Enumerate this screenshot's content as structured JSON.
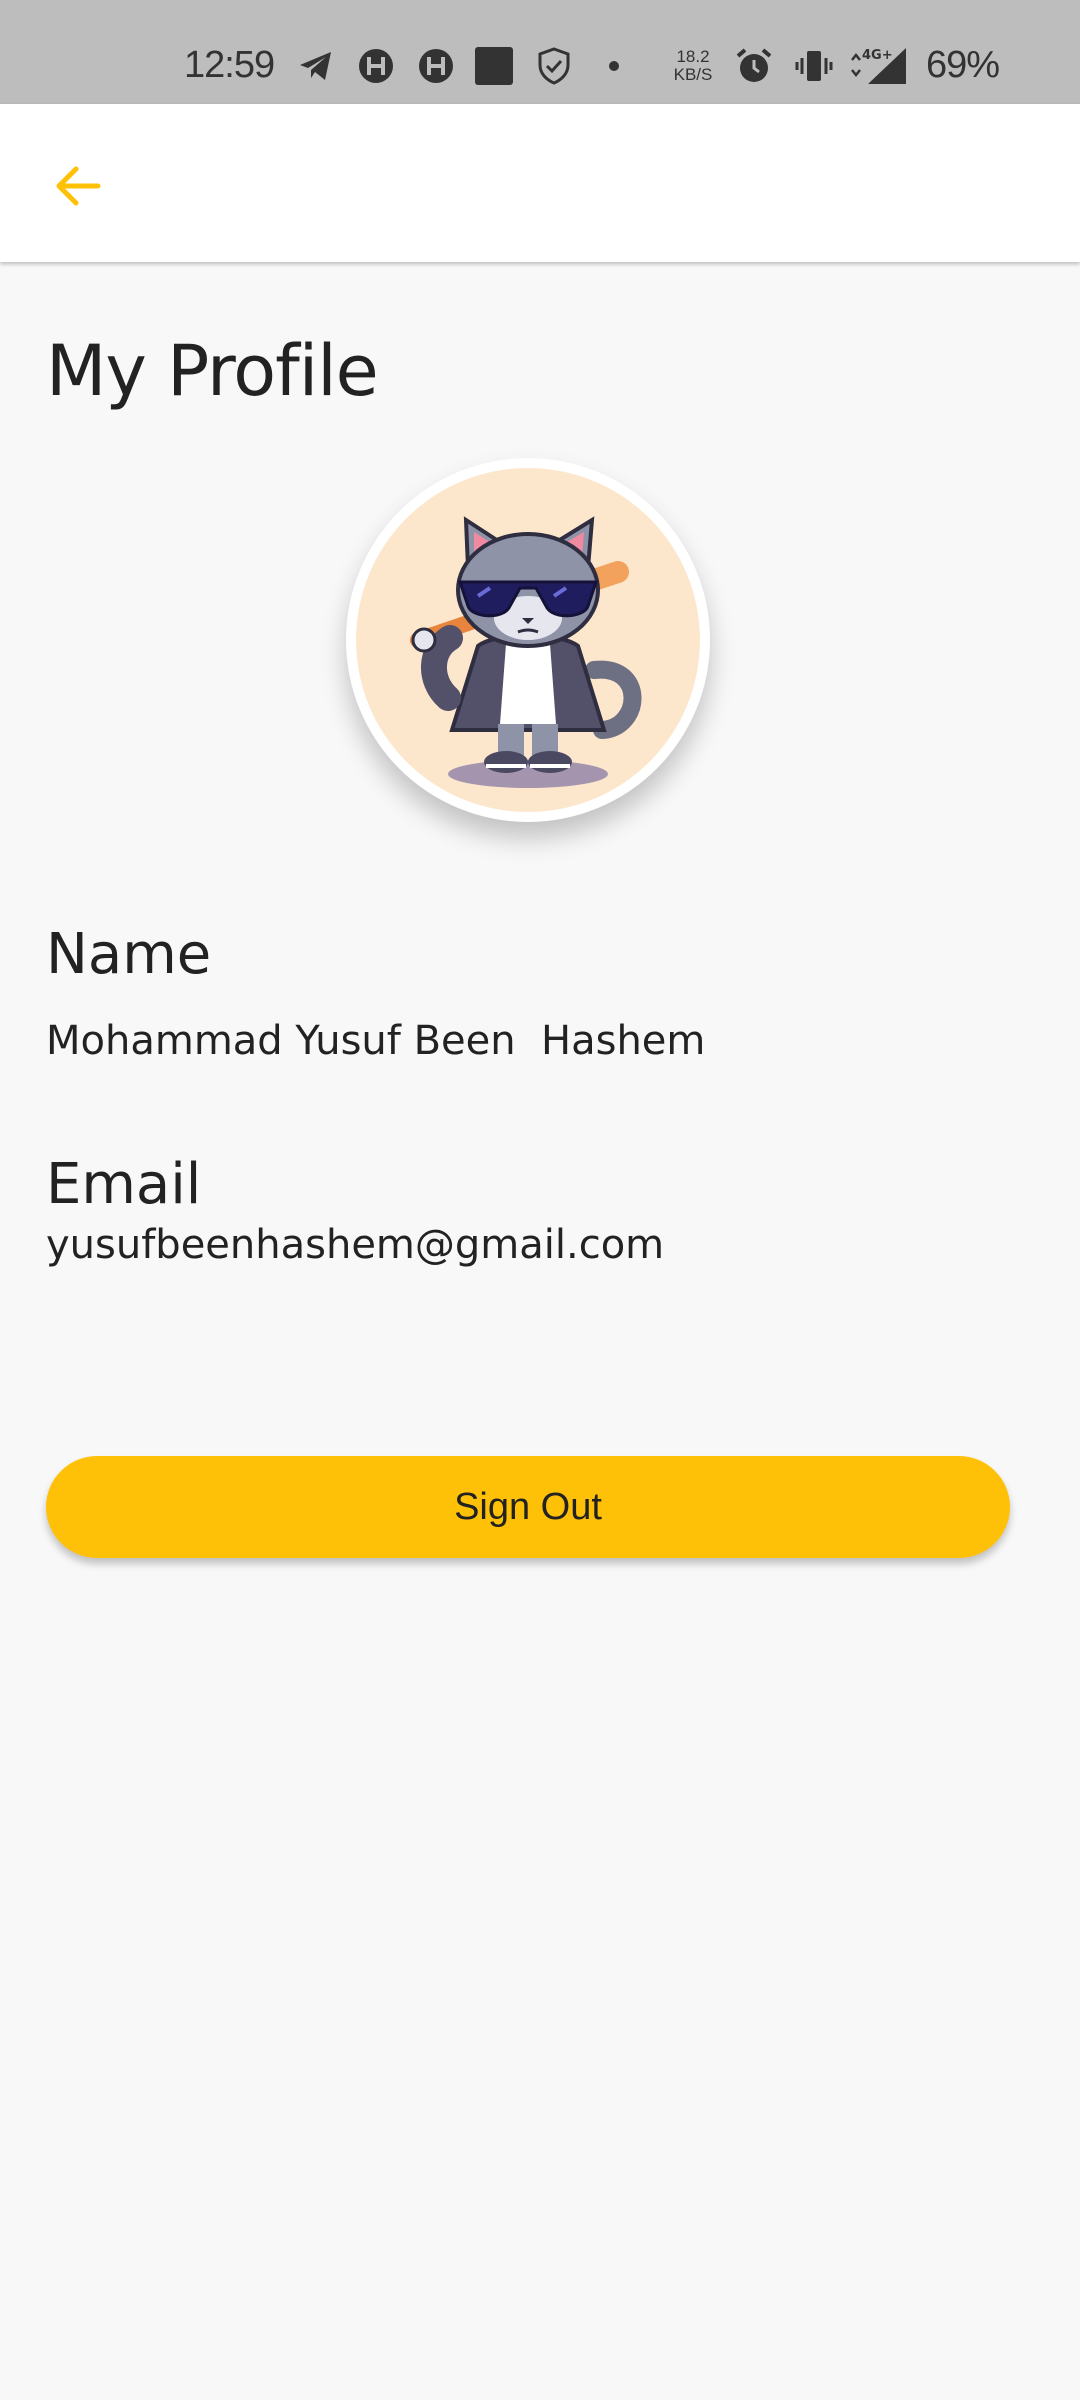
{
  "status_bar": {
    "time": "12:59",
    "net_speed_value": "18.2",
    "net_speed_unit": "KB/S",
    "battery": "69%",
    "icons": [
      "telegram-icon",
      "h-app-icon",
      "h-app-icon",
      "square-app-icon",
      "shield-icon",
      "dot-icon",
      "alarm-icon",
      "vibrate-icon",
      "signal-4g-icon"
    ]
  },
  "app_bar": {
    "back_icon": "arrow-left-icon",
    "accent_color": "#FFC107"
  },
  "profile": {
    "title": "My Profile",
    "avatar": "cat-with-sunglasses-and-bat-illustration",
    "name_label": "Name",
    "name_value": "Mohammad Yusuf Been  Hashem",
    "email_label": "Email",
    "email_value": "yusufbeenhashem@gmail.com"
  },
  "actions": {
    "sign_out_label": "Sign Out",
    "button_color": "#FFC107"
  }
}
